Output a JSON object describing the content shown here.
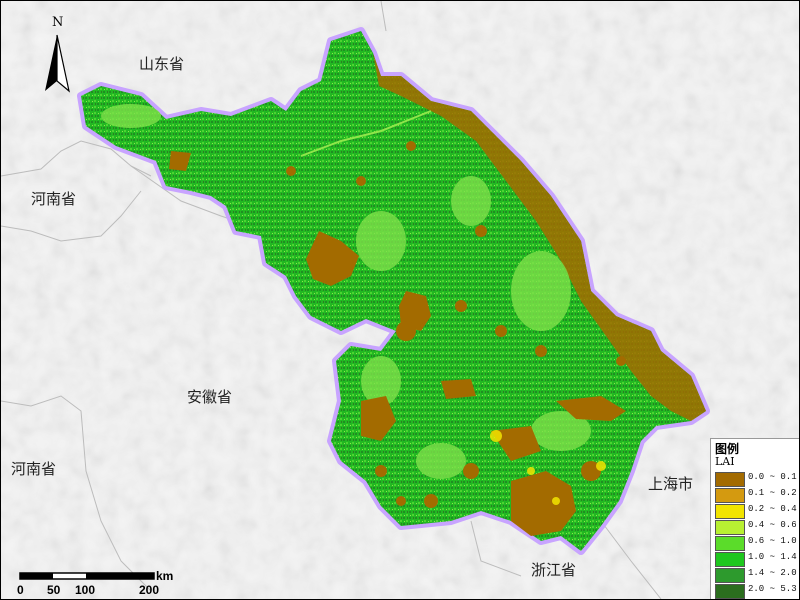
{
  "map": {
    "labels": {
      "shandong": "山东省",
      "henan_top": "河南省",
      "henan_bottom": "河南省",
      "anhui": "安徽省",
      "shanghai": "上海市",
      "zhejiang": "浙江省"
    },
    "north_arrow": {
      "letter": "N",
      "icon": "north-arrow-icon"
    },
    "scale_bar": {
      "labels": [
        "0",
        "50",
        "100",
        "200"
      ],
      "unit": "km"
    }
  },
  "legend": {
    "title": "图例",
    "subtitle": "LAI",
    "items": [
      {
        "range": "0.0 ~ 0.1",
        "color": "#a36b00"
      },
      {
        "range": "0.1 ~ 0.2",
        "color": "#d49a10"
      },
      {
        "range": "0.2 ~ 0.4",
        "color": "#f2e400"
      },
      {
        "range": "0.4 ~ 0.6",
        "color": "#b8f032"
      },
      {
        "range": "0.6 ~ 1.0",
        "color": "#5bdc2a"
      },
      {
        "range": "1.0 ~ 1.4",
        "color": "#1ec71e"
      },
      {
        "range": "1.4 ~ 2.0",
        "color": "#2d9a2d"
      },
      {
        "range": "2.0 ~ 5.3",
        "color": "#2b6e1e"
      }
    ]
  }
}
